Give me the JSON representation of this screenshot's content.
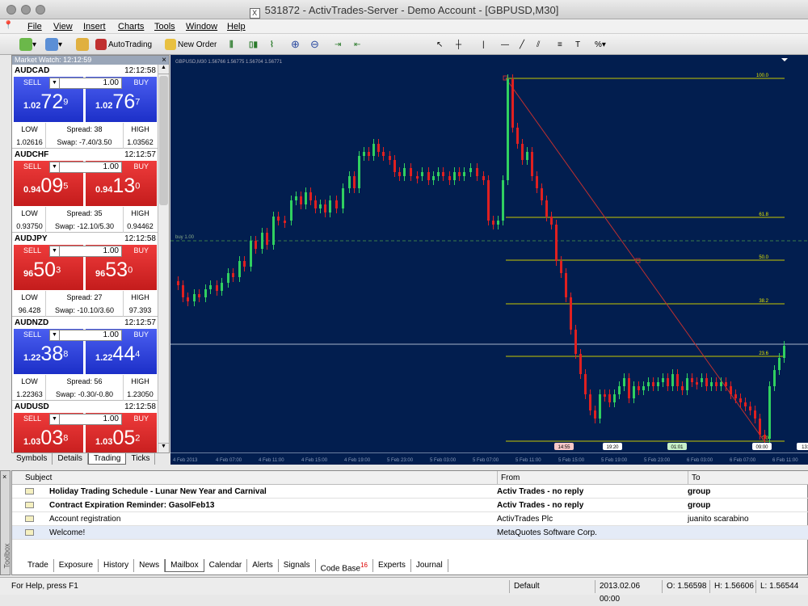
{
  "window": {
    "title": "531872 - ActivTrades-Server - Demo Account - [GBPUSD,M30]"
  },
  "menu": [
    "File",
    "View",
    "Insert",
    "Charts",
    "Tools",
    "Window",
    "Help"
  ],
  "toolbar": {
    "autotrading": "AutoTrading",
    "new_order": "New Order"
  },
  "market_watch": {
    "title": "Market Watch: 12:12:59",
    "sell": "SELL",
    "buy": "BUY",
    "symbols": [
      {
        "name": "AUDCAD",
        "time": "12:12:58",
        "lot": "1.00",
        "color": "blue",
        "sell_small": "1.02",
        "sell_big": "72",
        "sell_sup": "9",
        "buy_small": "1.02",
        "buy_big": "76",
        "buy_sup": "7",
        "low_label": "LOW",
        "low": "1.02616",
        "spread": "Spread: 38",
        "swap": "Swap: -7.40/3.50",
        "high_label": "HIGH",
        "high": "1.03562"
      },
      {
        "name": "AUDCHF",
        "time": "12:12:57",
        "lot": "1.00",
        "color": "red",
        "sell_small": "0.94",
        "sell_big": "09",
        "sell_sup": "5",
        "buy_small": "0.94",
        "buy_big": "13",
        "buy_sup": "0",
        "low_label": "LOW",
        "low": "0.93750",
        "spread": "Spread: 35",
        "swap": "Swap: -12.10/5.30",
        "high_label": "HIGH",
        "high": "0.94462"
      },
      {
        "name": "AUDJPY",
        "time": "12:12:58",
        "lot": "1.00",
        "color": "red",
        "sell_small": "96",
        "sell_big": "50",
        "sell_sup": "3",
        "buy_small": "96",
        "buy_big": "53",
        "buy_sup": "0",
        "low_label": "LOW",
        "low": "96.428",
        "spread": "Spread: 27",
        "swap": "Swap: -10.10/3.60",
        "high_label": "HIGH",
        "high": "97.393"
      },
      {
        "name": "AUDNZD",
        "time": "12:12:57",
        "lot": "1.00",
        "color": "blue",
        "sell_small": "1.22",
        "sell_big": "38",
        "sell_sup": "8",
        "buy_small": "1.22",
        "buy_big": "44",
        "buy_sup": "4",
        "low_label": "LOW",
        "low": "1.22363",
        "spread": "Spread: 56",
        "swap": "Swap: -0.30/-0.80",
        "high_label": "HIGH",
        "high": "1.23050"
      },
      {
        "name": "AUDUSD",
        "time": "12:12:58",
        "lot": "1.00",
        "color": "red",
        "sell_small": "1.03",
        "sell_big": "03",
        "sell_sup": "8",
        "buy_small": "1.03",
        "buy_big": "05",
        "buy_sup": "2"
      }
    ],
    "tabs": [
      "Symbols",
      "Details",
      "Trading",
      "Ticks"
    ]
  },
  "chart": {
    "header": "GBPUSD,M30  1.56766  1.56775  1.56704  1.56771",
    "buy_label": "buy 1.00",
    "fib_levels": [
      "100.0",
      "61.8",
      "50.0",
      "38.2",
      "23.6",
      "0.0"
    ],
    "time_tags": [
      "14:55",
      "19:20",
      "01:01",
      "09:00",
      "13:0"
    ],
    "xlabels": [
      "4 Feb 2013",
      "4 Feb 07:00",
      "4 Feb 11:00",
      "4 Feb 15:00",
      "4 Feb 19:00",
      "5 Feb 23:00",
      "5 Feb 03:00",
      "5 Feb 07:00",
      "5 Feb 11:00",
      "5 Feb 15:00",
      "5 Feb 19:00",
      "5 Feb 23:00",
      "6 Feb 03:00",
      "6 Feb 07:00",
      "6 Feb 11:00"
    ]
  },
  "toolbox": {
    "columns": [
      "Subject",
      "From",
      "To"
    ],
    "rows": [
      {
        "subject": "Holiday Trading Schedule - Lunar New Year and Carnival",
        "from": "Activ Trades - no reply",
        "to": "group",
        "bold": true
      },
      {
        "subject": "Contract Expiration Reminder: GasolFeb13",
        "from": "Activ Trades - no reply",
        "to": "group",
        "bold": true
      },
      {
        "subject": "Account registration",
        "from": "ActivTrades Plc",
        "to": "juanito scarabino",
        "bold": false
      },
      {
        "subject": "Welcome!",
        "from": "MetaQuotes Software Corp.",
        "to": "",
        "bold": false
      }
    ],
    "tabs": [
      "Trade",
      "Exposure",
      "History",
      "News",
      "Mailbox",
      "Calendar",
      "Alerts",
      "Signals",
      "Code Base",
      "Experts",
      "Journal"
    ],
    "codebase_badge": "16",
    "side": "Toolbox"
  },
  "status": {
    "help": "For Help, press F1",
    "profile": "Default",
    "datetime": "2013.02.06 00:00",
    "open": "O: 1.56598",
    "high": "H: 1.56606",
    "low": "L: 1.56544"
  }
}
